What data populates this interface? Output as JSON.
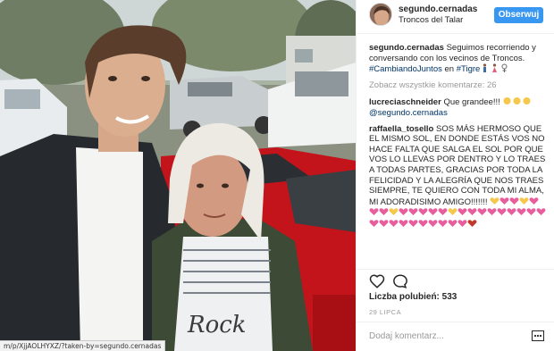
{
  "post": {
    "author": "segundo.cernadas",
    "location": "Troncos del Talar",
    "follow_label": "Obserwuj",
    "caption_text": "Seguimos recorriendo y conversando con los vecinos de Troncos.",
    "caption_hashtag": "#CambiandoJuntos",
    "caption_en": "en",
    "caption_tigre": "#Tigre",
    "load_more": "Zobacz wszystkie komentarze: 26",
    "likes_label": "Liczba polubień:",
    "likes_count": "533",
    "date": "29 LIPCA",
    "add_comment_placeholder": "Dodaj komentarz..."
  },
  "comments": [
    {
      "user": "lucreciaschneider",
      "text": "Que grandee!!!",
      "mention": "@segundo.cernadas"
    },
    {
      "user": "raffaella_tosello",
      "text": "SOS MÁS HERMOSO QUE EL MISMO SOL, EN DONDE ESTÁS VOS NO HACE FALTA QUE SALGA EL SOL POR QUE VOS LO LLEVAS POR DENTRO Y LO TRAES A TODAS PARTES, GRACIAS POR TODA LA FELICIDAD Y LA ALEGRÍA QUE NOS TRAES SIEMPRE, TE QUIERO CON TODA MI ALMA, MI ADORADISIMO AMIGO!!!!!!!"
    }
  ],
  "status_bar_url": "m/p/XjjAOLHYXZ/?taken-by=segundo.cernadas",
  "colors": {
    "accent": "#3897f0",
    "link": "#003569",
    "text": "#262626",
    "muted": "#999999"
  },
  "icons": [
    "heart-icon",
    "comment-icon",
    "more-dots-icon"
  ]
}
